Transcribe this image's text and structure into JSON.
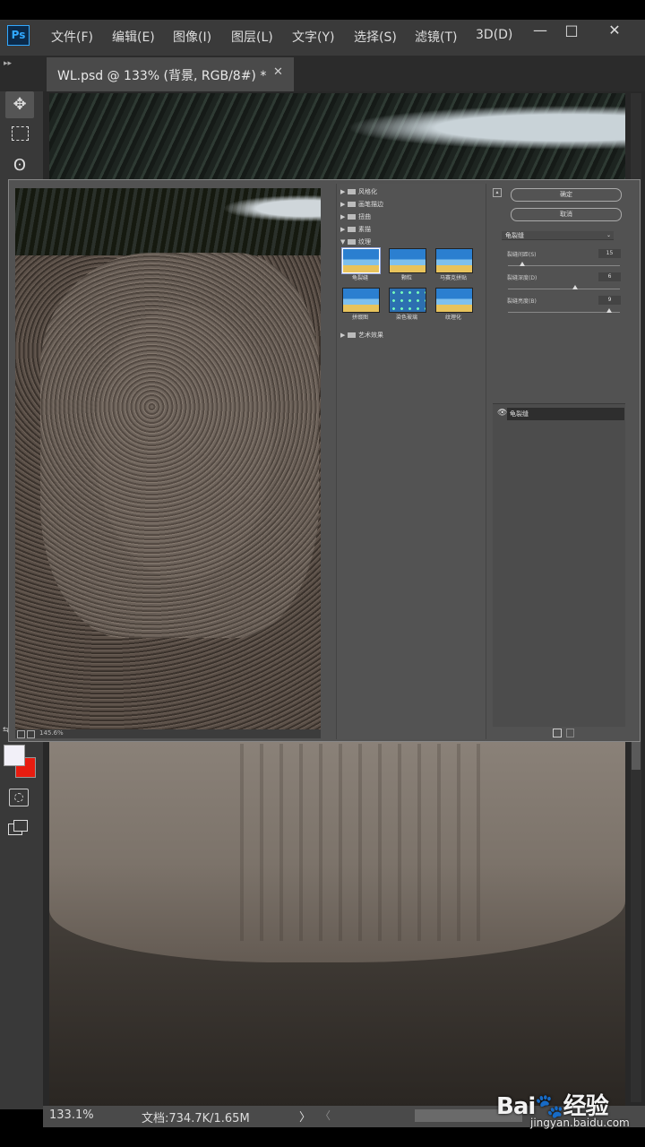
{
  "menu": {
    "logo": "Ps",
    "items": [
      "文件(F)",
      "编辑(E)",
      "图像(I)",
      "图层(L)",
      "文字(Y)",
      "选择(S)",
      "滤镜(T)",
      "3D(D)"
    ],
    "window_buttons": [
      "—",
      "□",
      "✕"
    ]
  },
  "document_tab": {
    "title": "WL.psd @ 133% (背景, RGB/8#) *",
    "close": "✕"
  },
  "tools": {
    "move": "✥",
    "lasso": "ʘ",
    "swap": "⇆",
    "foreground_color": "#f2f0f8",
    "background_color": "#e81c10"
  },
  "status": {
    "zoom": "133.1%",
    "doc_info": "文档:734.7K/1.65M",
    "arrow": "〉",
    "scroll_left": "〈"
  },
  "watermark": {
    "brand": "Bai🐾经验",
    "url": "jingyan.baidu.com"
  },
  "filter_gallery": {
    "preview_zoom": "145.6%",
    "folders": [
      {
        "label": "风格化",
        "expanded": false
      },
      {
        "label": "画笔描边",
        "expanded": false
      },
      {
        "label": "扭曲",
        "expanded": false
      },
      {
        "label": "素描",
        "expanded": false
      },
      {
        "label": "纹理",
        "expanded": true
      },
      {
        "label": "艺术效果",
        "expanded": false
      }
    ],
    "texture_filters": [
      "龟裂缝",
      "颗粒",
      "马赛克拼贴",
      "拼缀图",
      "染色玻璃",
      "纹理化"
    ],
    "buttons": {
      "ok": "确定",
      "cancel": "取消"
    },
    "selected_filter": "龟裂缝",
    "params": [
      {
        "label": "裂缝间距(S)",
        "value": "15",
        "level": 0.13
      },
      {
        "label": "裂缝深度(D)",
        "value": "6",
        "level": 0.6
      },
      {
        "label": "裂缝亮度(B)",
        "value": "9",
        "level": 0.9
      }
    ],
    "applied_effect": "龟裂缝"
  }
}
